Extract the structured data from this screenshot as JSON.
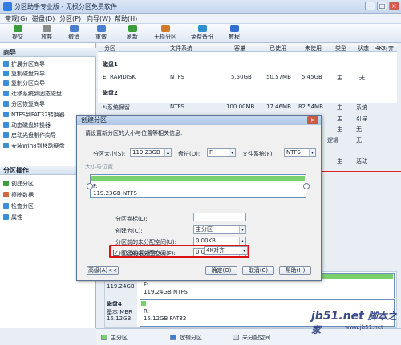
{
  "window": {
    "title": "分区助手专业版 - 无损分区免费软件",
    "controls": [
      "最小化",
      "最大化",
      "关闭"
    ]
  },
  "menu": [
    "常规(G)",
    "磁盘(D)",
    "分区(P)",
    "向导(W)",
    "帮助(H)"
  ],
  "toolbar": [
    {
      "label": "提交",
      "icon": "check-icon",
      "color": "#3a9f3a"
    },
    {
      "label": "放弃",
      "icon": "discard-icon",
      "color": "#8a8a8a"
    },
    {
      "label": "撤消",
      "icon": "undo-icon",
      "color": "#4a7fd0"
    },
    {
      "label": "重做",
      "icon": "redo-icon",
      "color": "#4a7fd0"
    },
    {
      "label": "刷新",
      "icon": "refresh-icon",
      "color": "#3a9f3a"
    },
    {
      "label": "无损分区",
      "icon": "partition-icon",
      "color": "#d07a2a"
    },
    {
      "label": "免费备份",
      "icon": "backup-icon",
      "color": "#2f8fd0"
    },
    {
      "label": "教程",
      "icon": "tutorial-icon",
      "color": "#2f6fd0"
    }
  ],
  "left_panel": {
    "wizard_header": "向导",
    "wizard_items": [
      "扩展分区向导",
      "复制磁盘向导",
      "复制分区向导",
      "迁移系统到固态磁盘",
      "分区恢复向导",
      "NTFS到FAT32转换器",
      "动态磁盘转换器",
      "启动光盘制作向导",
      "安装Win8到移动硬盘"
    ],
    "ops_header": "分区操作",
    "ops_items": [
      "创建分区",
      "擦除数据",
      "检查分区",
      "属性"
    ]
  },
  "table": {
    "headers": [
      "分区",
      "文件系统",
      "容量",
      "已使用",
      "未使用",
      "类型",
      "状态",
      "对齐"
    ],
    "right_header_value": "4K对齐",
    "disk1_label": "磁盘1",
    "disk1_rows": [
      {
        "partition": "E: RAMDISK",
        "fs": "NTFS",
        "capacity": "5.50GB",
        "used": "50.57MB",
        "free": "5.45GB",
        "type": "主",
        "status": "无"
      }
    ],
    "disk2_label": "磁盘2",
    "disk2_rows": [
      {
        "partition": "*:系统保留",
        "fs": "NTFS",
        "capacity": "100.00MB",
        "used": "17.46MB",
        "free": "82.54MB",
        "type": "主",
        "status": "系统"
      },
      {
        "partition": "",
        "fs": "",
        "capacity": "",
        "used": "",
        "free": "",
        "type": "主",
        "status": "引导"
      },
      {
        "partition": "",
        "fs": "",
        "capacity": "",
        "used": "",
        "free": "",
        "type": "主",
        "status": "无"
      },
      {
        "partition": "",
        "fs": "",
        "capacity": "",
        "used": "",
        "free": "逻辑",
        "type": "",
        "status": "无"
      },
      {
        "partition": "",
        "fs": "",
        "capacity": "",
        "used": "",
        "free": "",
        "type": "主",
        "status": "活动"
      }
    ]
  },
  "dialog": {
    "title": "创建分区",
    "description": "请设置新分区的大小与位置等相关信息.",
    "size_label": "分区大小(S):",
    "size_value": "119.23GB",
    "drive_label": "盘符(D):",
    "drive_value": "F:",
    "fs_label": "文件系统(F):",
    "fs_value": "NTFS",
    "group_caption": "大小与位置",
    "map_drive": "F:",
    "map_info": "119.23GB NTFS",
    "volume_label": "分区卷标(L):",
    "volume_value": "",
    "create_as_label": "创建为(C):",
    "create_as_value": "主分区",
    "before_label": "分区前的未分配空间(U):",
    "before_value": "0.00KB",
    "after_label": "分区后的未分配空间(F):",
    "after_value": "0.00KB",
    "ssd_label": "SSD分区对齐(A):",
    "ssd_checked": true,
    "ssd_value": "4K对齐",
    "advanced_button": "高级(A)<<",
    "ok_button": "确定(O)",
    "cancel_button": "取消(C)",
    "help_button": "帮助(H)"
  },
  "disk_map": {
    "row1": {
      "size_label": "119.24GB",
      "part_label": "F:",
      "part_info": "119.24GB NTFS"
    },
    "row2": {
      "name": "磁盘4",
      "type": "基本 MBR",
      "size": "15.12GB",
      "part_label": "R:",
      "part_info": "15.12GB FAT32"
    }
  },
  "legend": [
    "主分区",
    "逻辑分区",
    "未分配空间"
  ],
  "watermark": {
    "text": "jb51.net",
    "subtext": "脚本之家",
    "subtext2": "www.jb51.net"
  },
  "colors": {
    "primary": "#7bd06e",
    "logical": "#3b7fd8",
    "unallocated": "#d9dde3",
    "highlight": "#d11111"
  }
}
